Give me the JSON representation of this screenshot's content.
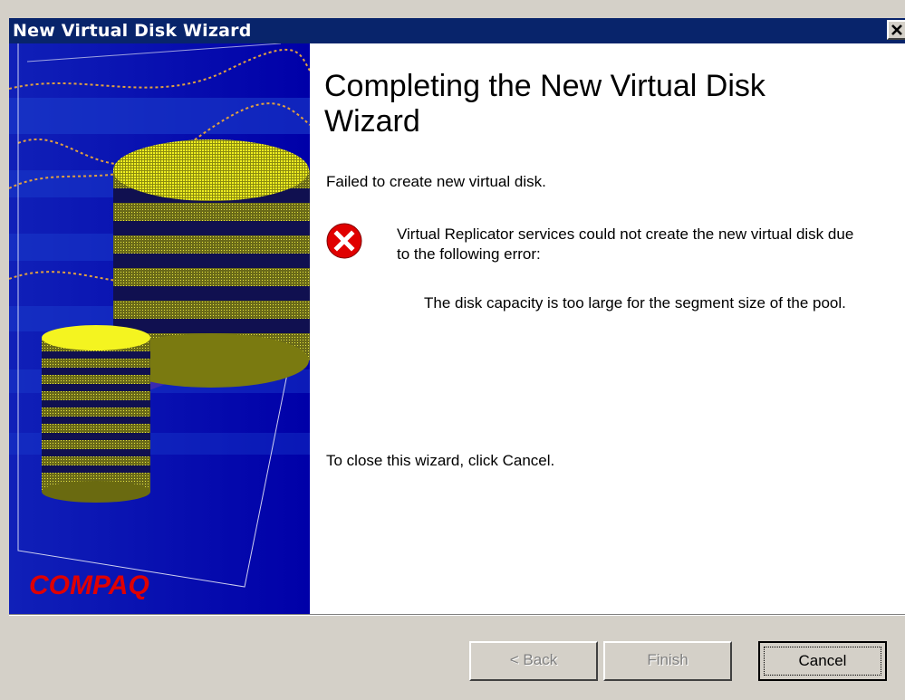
{
  "window": {
    "title": "New Virtual Disk Wizard",
    "close_glyph": "✕"
  },
  "sidebar": {
    "brand": "COMPAQ",
    "brand_color": "#e00000"
  },
  "content": {
    "heading": "Completing the New Virtual Disk Wizard",
    "status": "Failed to create new virtual disk.",
    "error_message": "Virtual Replicator services could not create the new virtual disk due to the following error:",
    "error_detail": "The disk capacity is too large for the segment size of the pool.",
    "close_hint": "To close this wizard, click Cancel.",
    "error_icon": "error-x-icon",
    "error_color": "#e00000"
  },
  "buttons": {
    "back": "< Back",
    "finish": "Finish",
    "cancel": "Cancel"
  }
}
